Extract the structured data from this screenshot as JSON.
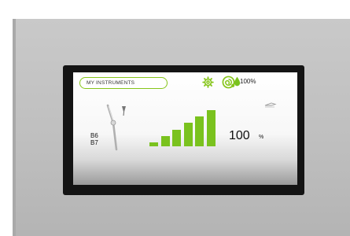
{
  "device": {
    "selected_menu": "MY INSTRUMENTS",
    "water_level": "100",
    "water_unit": "%",
    "instrument_ids": [
      "B6",
      "B7"
    ],
    "intensity_value": "100",
    "intensity_unit": "%",
    "intensity_level_fraction": 1.0,
    "intensity_bars": 6,
    "accent_color": "#7ac21e"
  },
  "icons": [
    "settings-icon",
    "spiral-icon",
    "water-drop-icon",
    "instrument-icon",
    "spray-icon"
  ]
}
